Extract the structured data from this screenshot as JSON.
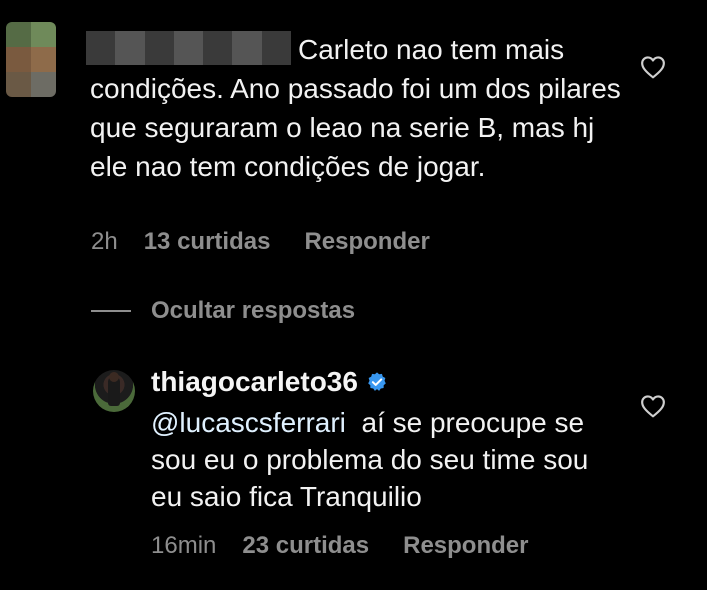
{
  "comment": {
    "text_line1": "Carleto nao tem mais",
    "text_rest": "condições. Ano passado foi um dos pilares que seguraram o leao na serie B, mas hj ele nao tem condições de jogar.",
    "time": "2h",
    "likes": "13 curtidas",
    "reply": "Responder"
  },
  "hide_replies": "Ocultar respostas",
  "reply_comment": {
    "username": "thiagocarleto36",
    "mention": "@lucascsferrari",
    "text": "aí se preocupe se sou eu o problema do seu time sou eu saio fica Tranquilio",
    "time": "16min",
    "likes": "23 curtidas",
    "reply": "Responder"
  },
  "colors": {
    "background": "#000000",
    "text": "#f2f2f2",
    "muted": "#8e8e8e",
    "verified": "#3897f0"
  }
}
